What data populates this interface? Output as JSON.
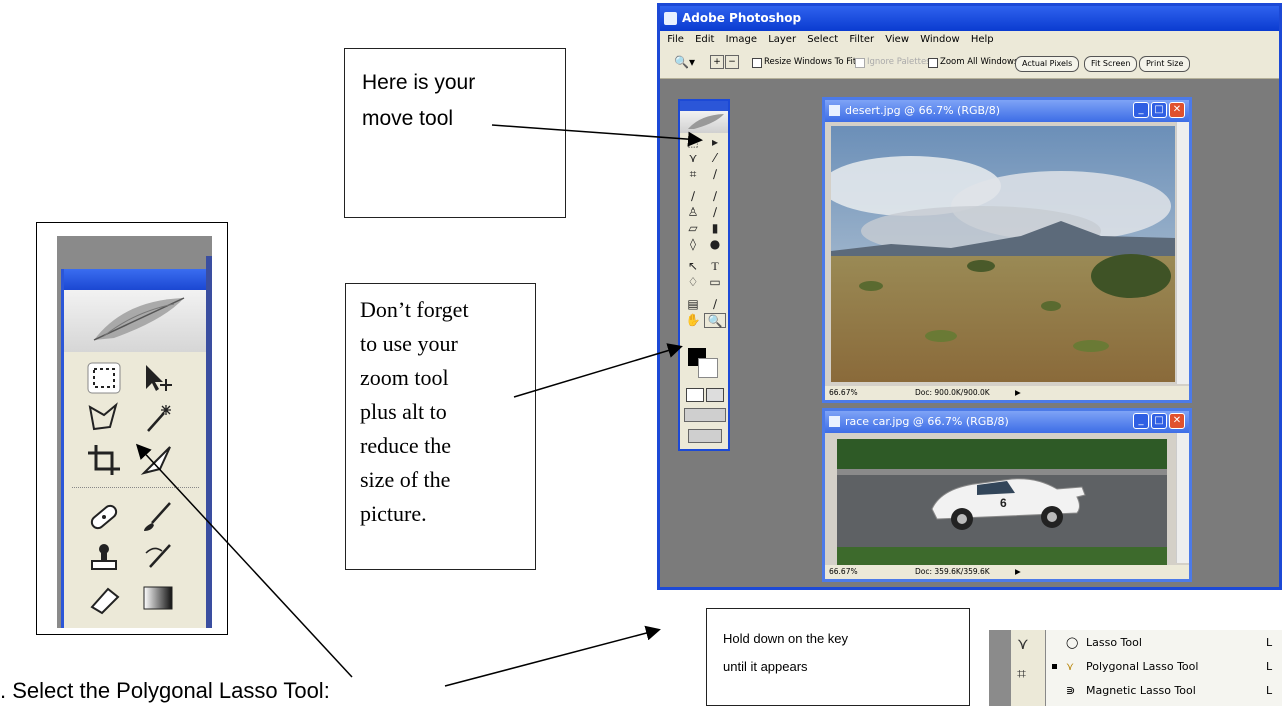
{
  "callouts": {
    "move_tool": {
      "line1": "Here is your",
      "line2": "move tool"
    },
    "zoom_tool": {
      "lines": [
        "Don’t forget",
        "to use your",
        "zoom tool",
        "plus alt to",
        "reduce the",
        "size of the",
        "picture."
      ]
    },
    "hold_key": {
      "line1": "Hold down on  the key",
      "line2": "until it appears"
    }
  },
  "instruction": {
    "text": ".  Select the Polygonal Lasso Tool:"
  },
  "photoshop": {
    "title": "Adobe Photoshop",
    "menu": [
      "File",
      "Edit",
      "Image",
      "Layer",
      "Select",
      "Filter",
      "View",
      "Window",
      "Help"
    ],
    "options": {
      "resize_windows": "Resize Windows To Fit",
      "ignore_palettes": "Ignore Palettes",
      "zoom_all": "Zoom All Windows",
      "actual_pixels": "Actual Pixels",
      "fit_screen": "Fit Screen",
      "print_size": "Print Size"
    },
    "doc1": {
      "title": "desert.jpg @ 66.7% (RGB/8)",
      "zoom": "66.67%",
      "doc": "Doc: 900.0K/900.0K"
    },
    "doc2": {
      "title": "race car.jpg @ 66.7% (RGB/8)",
      "zoom": "66.67%",
      "doc": "Doc: 359.6K/359.6K"
    }
  },
  "popup": {
    "items": [
      {
        "label": "Lasso Tool",
        "key": "L",
        "selected": false
      },
      {
        "label": "Polygonal Lasso Tool",
        "key": "L",
        "selected": true
      },
      {
        "label": "Magnetic Lasso Tool",
        "key": "L",
        "selected": false
      }
    ]
  },
  "car_number": "6",
  "icons": [
    "photoshop-logo-icon",
    "marquee-icon",
    "move-icon",
    "polygonal-lasso-icon",
    "magic-wand-icon",
    "crop-icon",
    "slice-icon",
    "healing-brush-icon",
    "brush-icon",
    "clone-stamp-icon",
    "history-brush-icon",
    "eraser-icon",
    "gradient-icon",
    "zoom-icon",
    "hand-icon",
    "lasso-icon",
    "magnetic-lasso-icon"
  ],
  "colors": {
    "xp_blue": "#1c49d6",
    "panel_bg": "#ece9d8",
    "workspace": "#7b7b7b",
    "close_red": "#e0512e"
  }
}
